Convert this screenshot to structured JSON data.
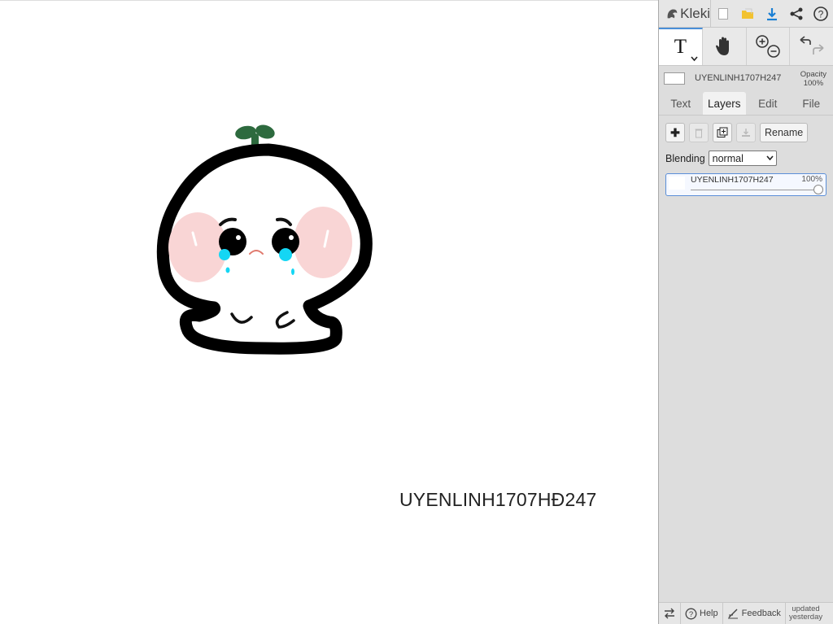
{
  "app": {
    "logo_text": "Kleki"
  },
  "toolbar": {
    "icons": [
      "new-image-icon",
      "open-file-icon",
      "download-icon",
      "share-icon",
      "help-icon"
    ]
  },
  "tools": {
    "text_tool_glyph": "T",
    "icons": [
      "text-tool-icon",
      "hand-tool-icon",
      "zoom-icon",
      "undo-redo-icon"
    ]
  },
  "brush": {
    "name": "UYENLINH1707H247",
    "opacity_label": "Opacity",
    "opacity_value": "100%"
  },
  "tabs": [
    {
      "label": "Text",
      "active": false
    },
    {
      "label": "Layers",
      "active": true
    },
    {
      "label": "Edit",
      "active": false
    },
    {
      "label": "File",
      "active": false
    }
  ],
  "layers_panel": {
    "rename_label": "Rename",
    "blending_label": "Blending",
    "blending_value": "normal",
    "layers": [
      {
        "name": "UYENLINH1707H247",
        "opacity": "100%",
        "opacity_fraction": 1.0,
        "selected": true
      }
    ]
  },
  "canvas": {
    "text": "UYENLINH1707HĐ247"
  },
  "bottombar": {
    "help_label": "Help",
    "feedback_label": "Feedback",
    "updated_line1": "updated",
    "updated_line2": "yesterday"
  }
}
